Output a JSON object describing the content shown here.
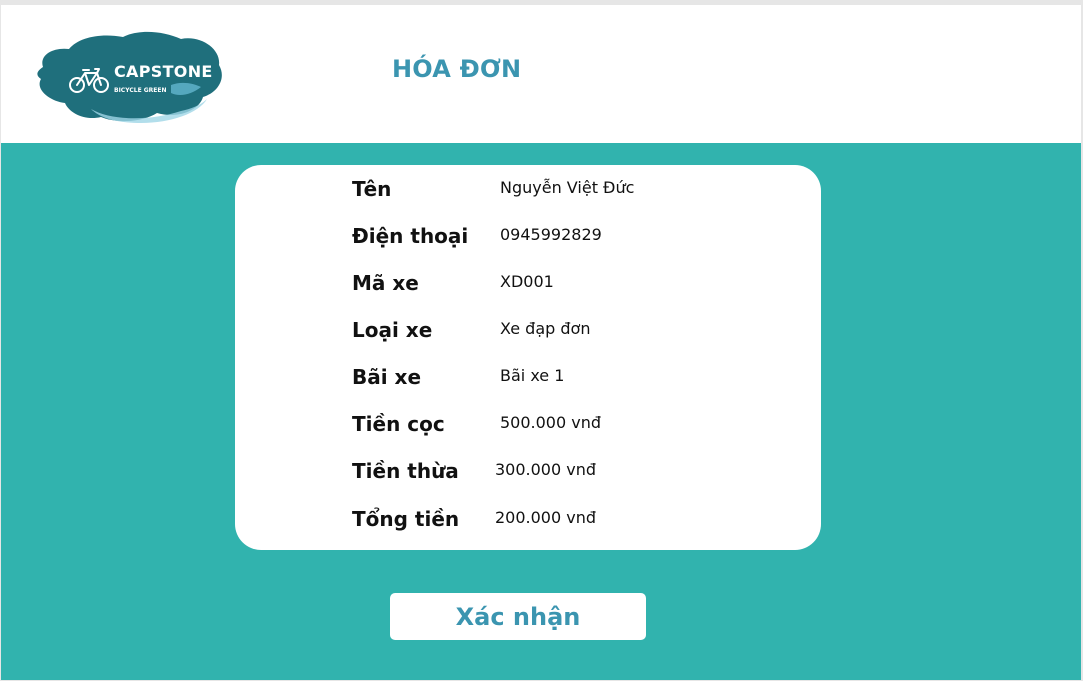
{
  "header": {
    "title": "HÓA ĐƠN",
    "logo": {
      "brand": "CAPSTONE",
      "tagline": "BICYCLE GREEN",
      "icon": "bicycle-icon"
    }
  },
  "invoice": {
    "rows": [
      {
        "label": "Tên",
        "value": "Nguyễn Việt Đức"
      },
      {
        "label": "Điện thoại",
        "value": "0945992829"
      },
      {
        "label": "Mã xe",
        "value": "XD001"
      },
      {
        "label": "Loại xe",
        "value": "Xe đạp đơn"
      },
      {
        "label": "Bãi xe",
        "value": "Bãi xe 1"
      },
      {
        "label": "Tiền cọc",
        "value": "500.000 vnđ"
      },
      {
        "label": "Tiền thừa",
        "value": "300.000 vnđ"
      },
      {
        "label": "Tổng tiền",
        "value": "200.000 vnđ"
      }
    ]
  },
  "actions": {
    "confirm_label": "Xác nhận"
  },
  "colors": {
    "accent": "#3b95b0",
    "background": "#31b3ae",
    "logo_blob": "#1f6f7c"
  }
}
